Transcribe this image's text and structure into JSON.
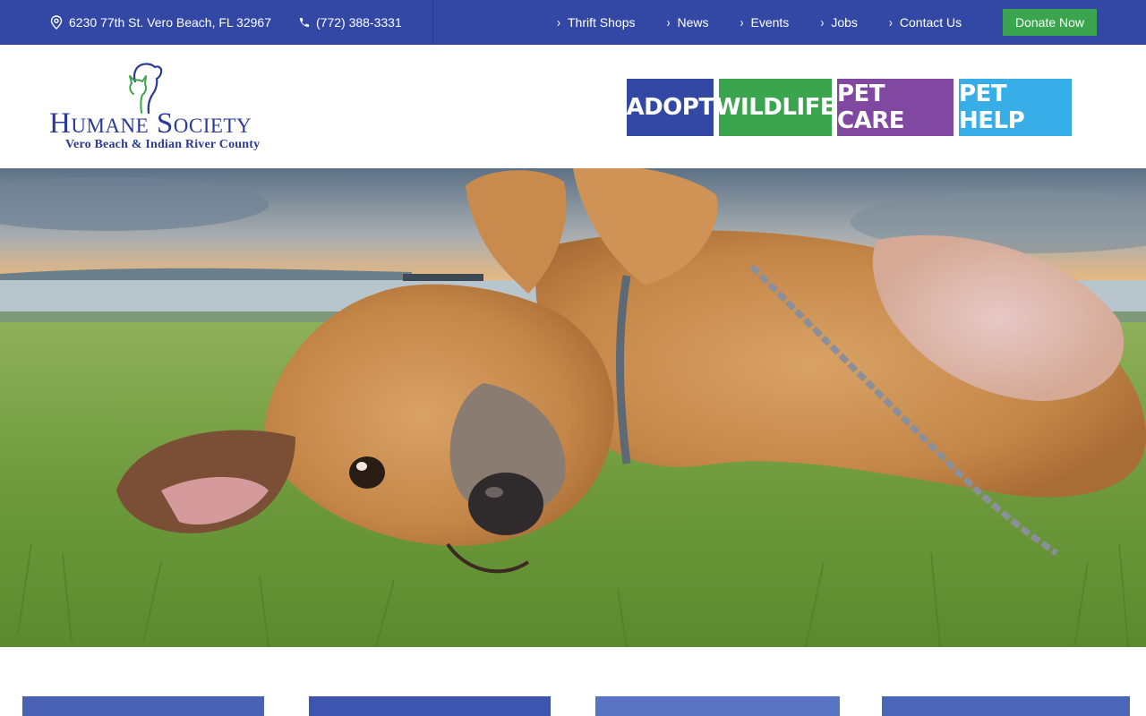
{
  "topbar": {
    "address": "6230 77th St. Vero Beach, FL 32967",
    "phone": "(772) 388-3331",
    "links": [
      {
        "label": "Thrift Shops"
      },
      {
        "label": "News"
      },
      {
        "label": "Events"
      },
      {
        "label": "Jobs"
      },
      {
        "label": "Contact Us"
      }
    ],
    "donate_label": "Donate Now"
  },
  "logo": {
    "name": "Humane Society",
    "subtitle": "Vero Beach & Indian River County"
  },
  "mainnav": [
    {
      "label": "ADOPT",
      "color": "#3348a5"
    },
    {
      "label": "WILDLIFE",
      "color": "#3aa44e"
    },
    {
      "label": "PET CARE",
      "color": "#8148a2"
    },
    {
      "label": "PET HELP",
      "color": "#37aee8"
    }
  ],
  "colors": {
    "brand_blue": "#3348a5",
    "green": "#3aa44e",
    "purple": "#8148a2",
    "light_blue": "#37aee8"
  }
}
